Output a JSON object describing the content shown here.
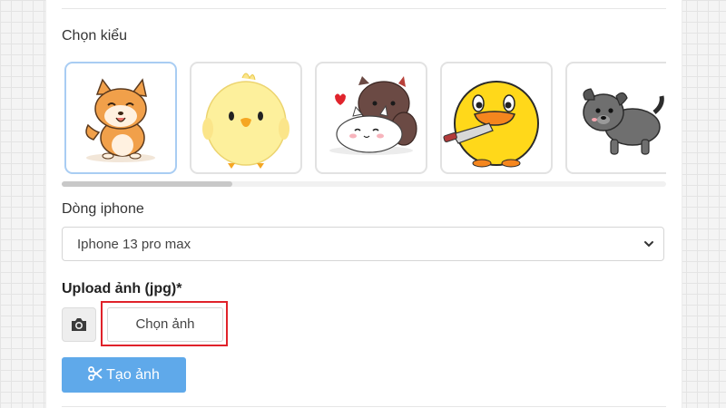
{
  "form": {
    "style_label": "Chọn kiểu",
    "phone_label": "Dòng iphone",
    "phone_selected": "Iphone 13 pro max",
    "upload_label": "Upload ảnh (jpg)*",
    "choose_button": "Chọn ảnh",
    "create_button": "Tạo ảnh"
  },
  "stickers": [
    {
      "name": "shiba-dog-sticker",
      "selected": true
    },
    {
      "name": "yellow-chick-sticker",
      "selected": false
    },
    {
      "name": "cats-couple-sticker",
      "selected": false
    },
    {
      "name": "duck-with-knife-sticker",
      "selected": false
    },
    {
      "name": "grey-dog-sticker",
      "selected": false
    }
  ],
  "icons": {
    "camera": "camera-icon",
    "scissors": "scissors-icon",
    "dropdown": "chevron-down-icon"
  },
  "colors": {
    "primary_button": "#5fa9ea",
    "selected_border": "#a9cdf3",
    "highlight_box": "#e0222a"
  }
}
